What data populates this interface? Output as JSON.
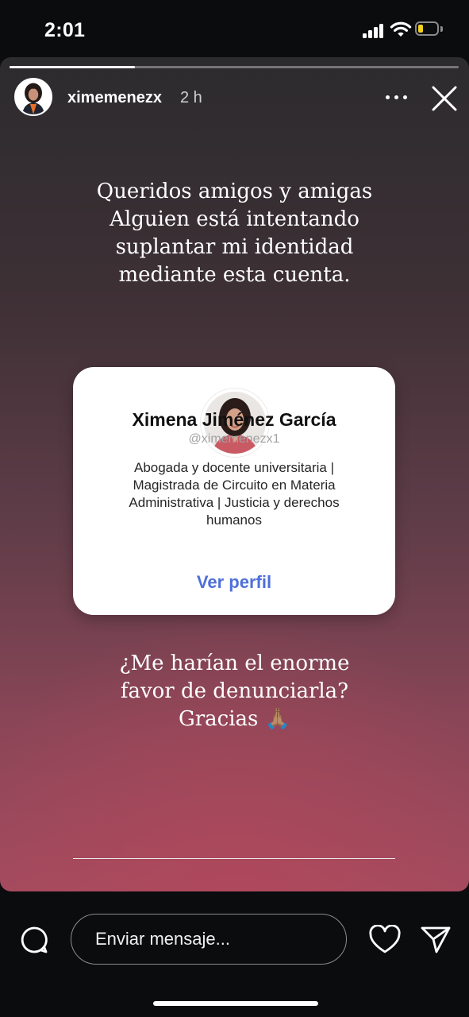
{
  "status_bar": {
    "time": "2:01",
    "icons": [
      "cellular-signal-icon",
      "wifi-icon",
      "battery-icon"
    ],
    "battery_level": 0.25,
    "battery_color": "#f2d21b"
  },
  "story": {
    "progress": 0.28,
    "username": "ximemenezx",
    "time_ago": "2 h",
    "message_top": "Queridos amigos y amigas\nAlguien está intentando\nsuplantar mi identidad\nmediante esta cuenta.",
    "message_bottom": "¿Me harían el enorme\nfavor de denunciarla?\nGracias 🙏🏽",
    "profile_card": {
      "name": "Ximena Jiménez García",
      "handle": "@ximemenezx1",
      "bio": "Abogada y docente universitaria | Magistrada de Circuito en Materia Administrativa | Justicia y derechos humanos",
      "button_label": "Ver perfil",
      "button_color": "#4e6fd9"
    }
  },
  "bottom_bar": {
    "message_placeholder": "Enviar mensaje...",
    "icons": [
      "comment-bubble-icon",
      "heart-icon",
      "send-icon"
    ]
  }
}
